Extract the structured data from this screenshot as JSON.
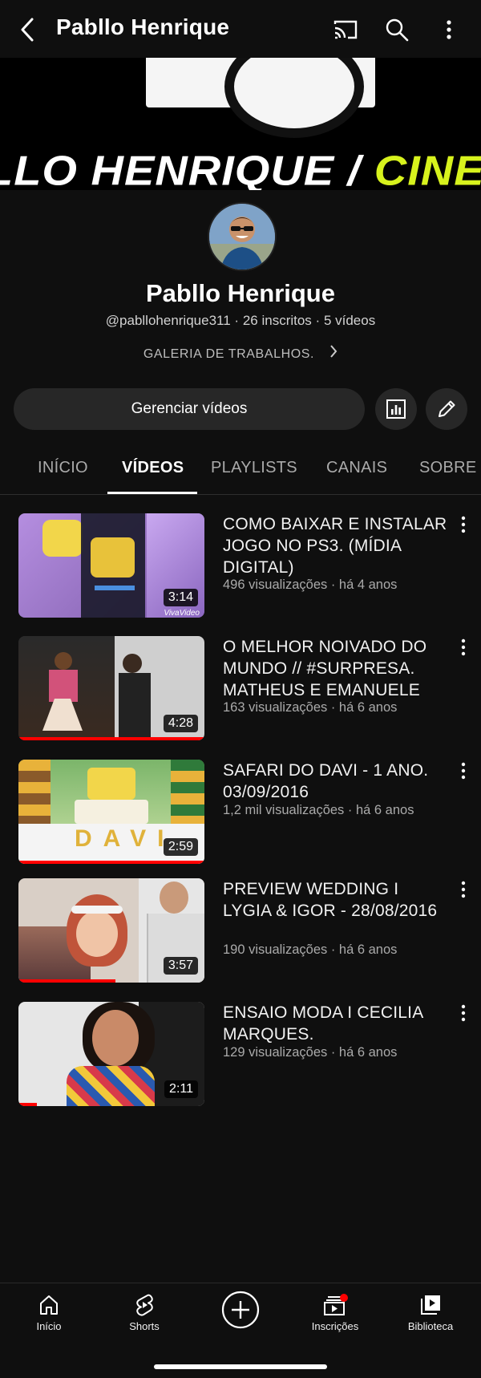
{
  "header": {
    "title": "Pabllo Henrique",
    "icons": [
      "back-icon",
      "cast-icon",
      "search-icon",
      "more-vert-icon"
    ]
  },
  "banner": {
    "text_white": "LLO HENRIQUE  /",
    "text_yellow": " CINE - FOTOG",
    "accent_color": "#d7f21d"
  },
  "channel": {
    "name": "Pabllo Henrique",
    "handle": "@pabllohenrique311",
    "subscribers": "26 inscritos",
    "videos_count": "5 vídeos",
    "separator": "·",
    "description": "GALERIA DE TRABALHOS."
  },
  "actions": {
    "manage_label": "Gerenciar vídeos",
    "icons": [
      "analytics-icon",
      "edit-pencil-icon"
    ]
  },
  "tabs": [
    {
      "label": "INÍCIO",
      "active": false
    },
    {
      "label": "VÍDEOS",
      "active": true
    },
    {
      "label": "PLAYLISTS",
      "active": false
    },
    {
      "label": "CANAIS",
      "active": false
    },
    {
      "label": "SOBRE",
      "active": false
    }
  ],
  "videos": [
    {
      "title": "COMO BAIXAR E INSTALAR JOGO NO PS3. (MÍDIA DIGITAL)",
      "meta": "496 visualizações · há 4 anos",
      "duration": "3:14",
      "watermark": "VivaVideo",
      "watched_fraction": 0
    },
    {
      "title": "O MELHOR NOIVADO DO MUNDO // #SURPRESA. MATHEUS E EMANUELE",
      "meta": "163 visualizações · há 6 anos",
      "duration": "4:28",
      "watched_fraction": 1.0
    },
    {
      "title": "SAFARI DO DAVI - 1 ANO. 03/09/2016",
      "meta": "1,2 mil visualizações · há 6 anos",
      "duration": "2:59",
      "watched_fraction": 1.0
    },
    {
      "title": "PREVIEW WEDDING  I LYGIA & IGOR - 28/08/2016",
      "meta": "190 visualizações · há 6 anos",
      "duration": "3:57",
      "watched_fraction": 0.52
    },
    {
      "title": "ENSAIO MODA I CECILIA MARQUES.",
      "meta": "129 visualizações · há 6 anos",
      "duration": "2:11",
      "watched_fraction": 0.1
    }
  ],
  "bottom_nav": [
    {
      "label": "Início",
      "icon": "home-icon"
    },
    {
      "label": "Shorts",
      "icon": "shorts-icon"
    },
    {
      "label": "",
      "icon": "create-plus-icon"
    },
    {
      "label": "Inscrições",
      "icon": "subscriptions-icon",
      "badge": true
    },
    {
      "label": "Biblioteca",
      "icon": "library-icon"
    }
  ],
  "colors": {
    "background": "#0f0f0f",
    "progress": "#ff0000",
    "badge": "#ff0000"
  }
}
